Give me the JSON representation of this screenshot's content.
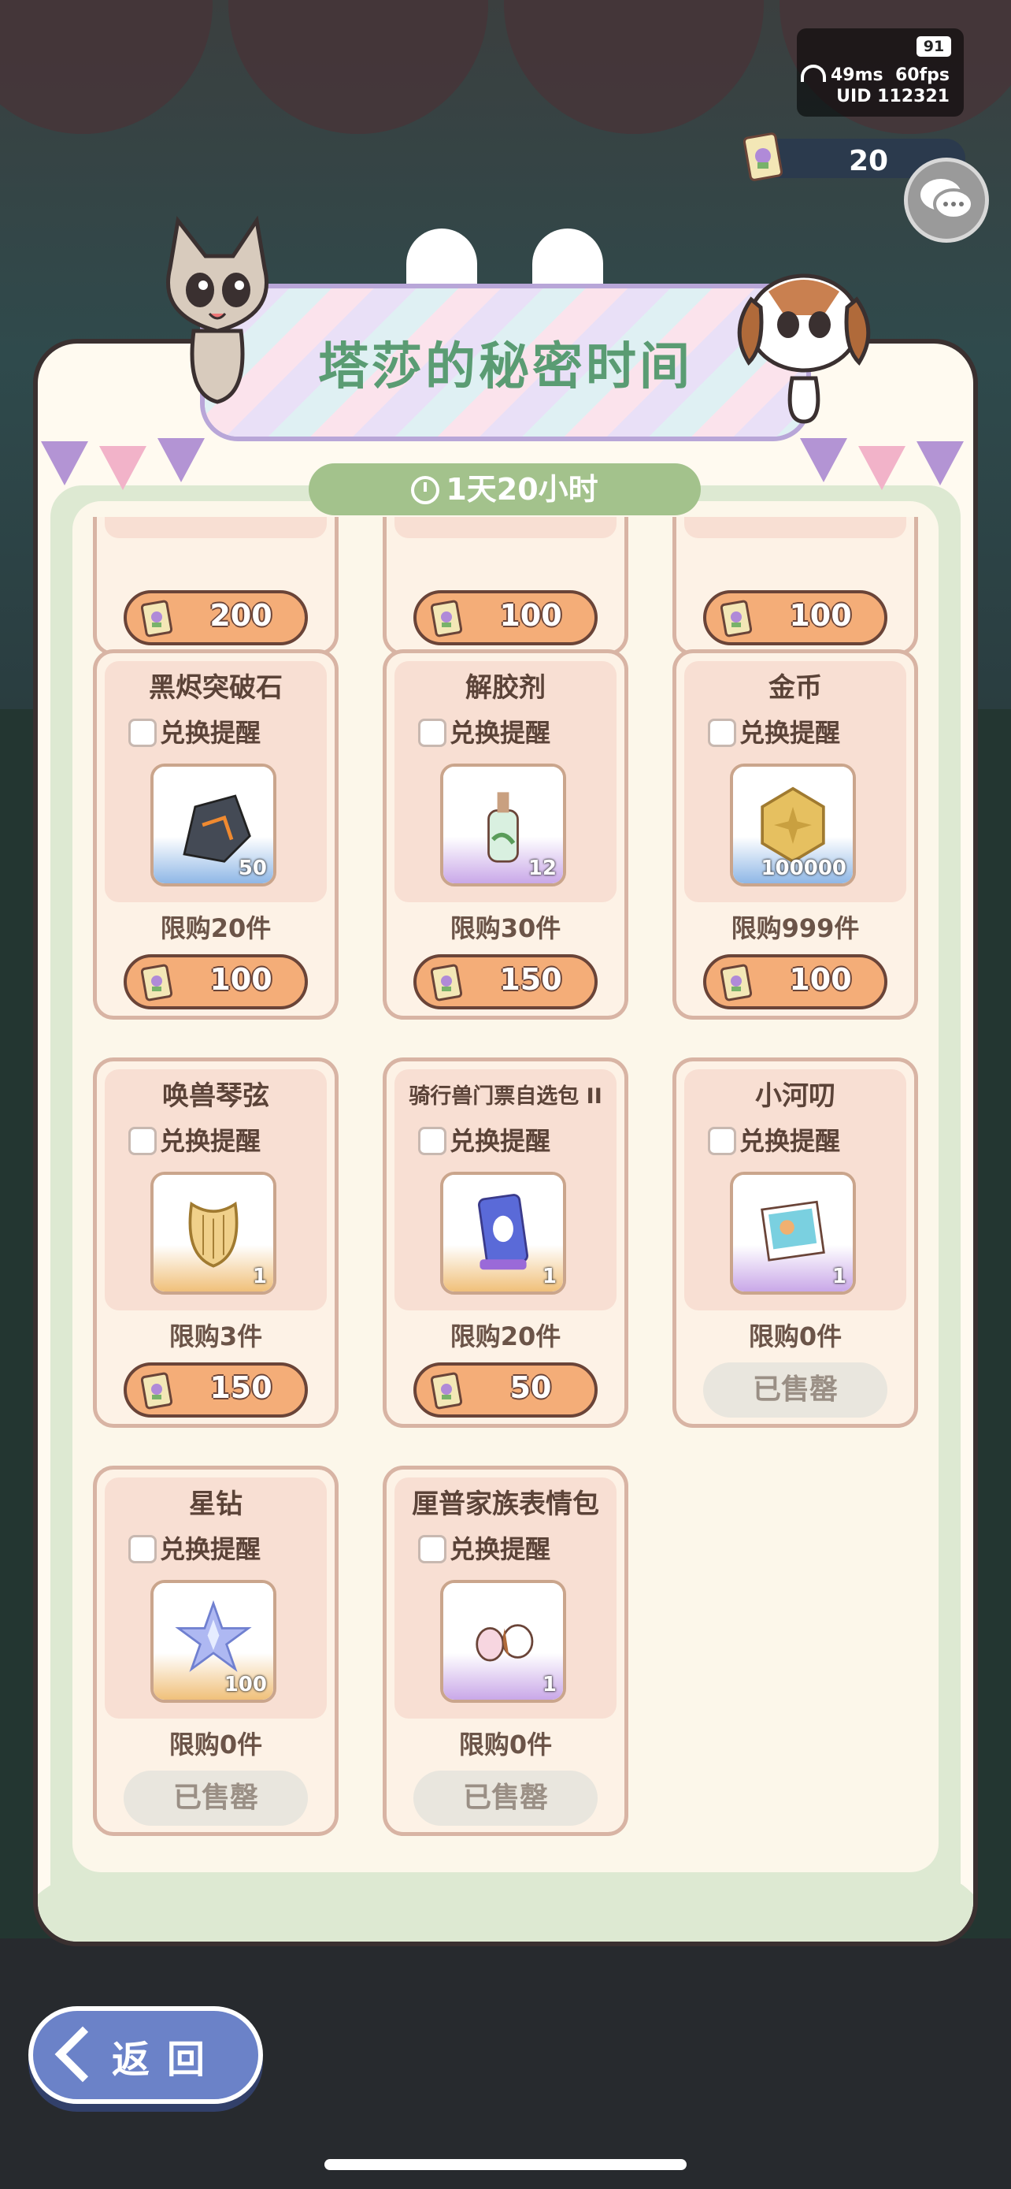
{
  "status": {
    "battery": "91",
    "ping": "49ms",
    "fps": "60fps",
    "uid": "UID 112321"
  },
  "currency": {
    "value": "20",
    "icon": "ticket-icon"
  },
  "header": {
    "title": "塔莎的秘密时间"
  },
  "timer": {
    "label": "1天20小时"
  },
  "remind_label": "兑换提醒",
  "sold_out_label": "已售罄",
  "items": [
    {
      "name": "",
      "limit": "",
      "price": "200",
      "sold_out": false
    },
    {
      "name": "",
      "limit": "",
      "price": "100",
      "sold_out": false
    },
    {
      "name": "",
      "limit": "",
      "price": "100",
      "sold_out": false
    },
    {
      "name": "黑烬突破石",
      "qty": "50",
      "limit": "限购20件",
      "price": "100",
      "sold_out": false,
      "color": "#8fb7e6",
      "icon": "black-stone-icon"
    },
    {
      "name": "解胶剂",
      "qty": "12",
      "limit": "限购30件",
      "price": "150",
      "sold_out": false,
      "color": "#c9a8e8",
      "icon": "potion-bottle-icon"
    },
    {
      "name": "金币",
      "qty": "100000",
      "limit": "限购999件",
      "price": "100",
      "sold_out": false,
      "color": "#8fb7e6",
      "icon": "gold-coin-icon"
    },
    {
      "name": "唤兽琴弦",
      "qty": "1",
      "limit": "限购3件",
      "price": "150",
      "sold_out": false,
      "color": "#f0c07a",
      "icon": "harp-icon"
    },
    {
      "name": "骑行兽门票自选包 II",
      "qty": "1",
      "limit": "限购20件",
      "price": "50",
      "sold_out": false,
      "color": "#f0c07a",
      "icon": "ride-ticket-icon"
    },
    {
      "name": "小河叨",
      "qty": "1",
      "limit": "限购0件",
      "price": "",
      "sold_out": true,
      "color": "#c9a8e8",
      "icon": "photo-card-icon"
    },
    {
      "name": "星钻",
      "qty": "100",
      "limit": "限购0件",
      "price": "",
      "sold_out": true,
      "color": "#f0c07a",
      "icon": "star-diamond-icon"
    },
    {
      "name": "厘普家族表情包",
      "qty": "1",
      "limit": "限购0件",
      "price": "",
      "sold_out": true,
      "color": "#c9a8e8",
      "icon": "emoji-pack-icon"
    }
  ],
  "back": {
    "label": "返回"
  },
  "colors": {
    "accent_green": "#5a9c73",
    "price_orange": "#f4ad78",
    "panel_border": "#3a3030"
  }
}
